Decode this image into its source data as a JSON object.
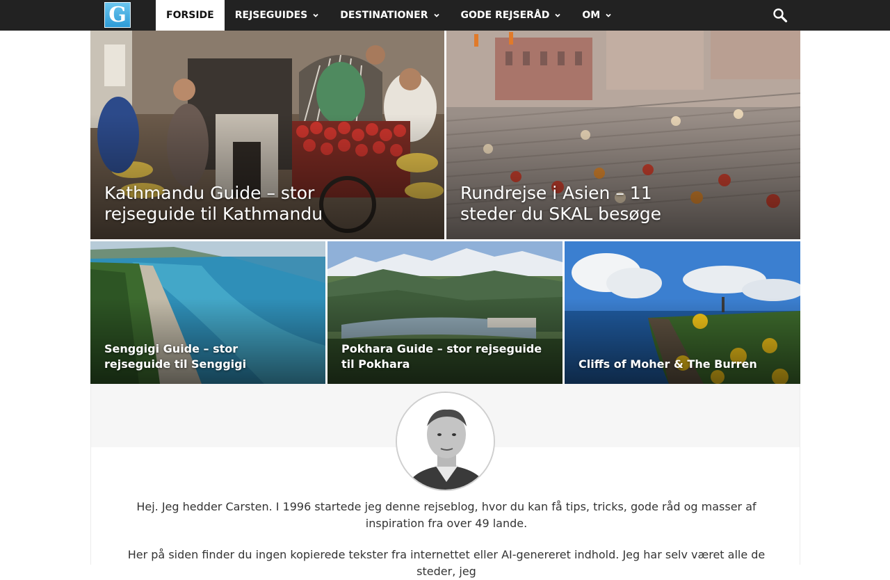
{
  "header": {
    "logo_letter": "G",
    "nav": [
      {
        "label": "FORSIDE",
        "active": true
      },
      {
        "label": "REJSEGUIDES",
        "dropdown": true
      },
      {
        "label": "DESTINATIONER",
        "dropdown": true
      },
      {
        "label": "GODE REJSERÅD",
        "dropdown": true
      },
      {
        "label": "OM",
        "dropdown": true
      }
    ],
    "search_icon": "search-icon"
  },
  "featured": [
    {
      "title": "Kathmandu Guide – stor rejseguide til Kathmandu"
    },
    {
      "title": "Rundrejse i Asien – 11 steder du SKAL besøge"
    },
    {
      "title": "Senggigi Guide – stor rejseguide til Senggigi"
    },
    {
      "title": "Pokhara Guide – stor rejseguide til Pokhara"
    },
    {
      "title": "Cliffs of Moher & The Burren"
    }
  ],
  "author": {
    "bio_1": "Hej. Jeg hedder Carsten. I 1996 startede jeg denne rejseblog, hvor du kan få tips, tricks, gode råd og masser af inspiration fra over 49 lande.",
    "bio_2": "Her på siden finder du ingen kopierede tekster fra internettet eller AI-genereret indhold. Jeg har selv været alle de steder, jeg"
  },
  "colors": {
    "nav_bg": "#222222",
    "nav_active_bg": "#ffffff",
    "logo_blue": "#2d9bd6"
  }
}
